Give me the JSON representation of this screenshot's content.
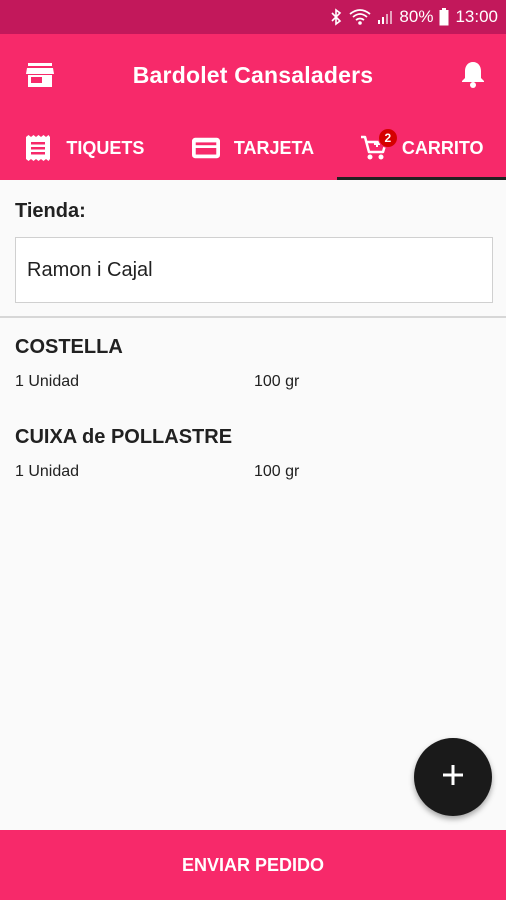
{
  "status_bar": {
    "battery": "80%",
    "time": "13:00",
    "icons": [
      "bluetooth-icon",
      "wifi-icon",
      "signal-icon",
      "battery-icon"
    ]
  },
  "app_bar": {
    "title": "Bardolet Cansaladers",
    "left_icon": "store-icon",
    "right_icon": "bell-icon"
  },
  "tabs": [
    {
      "label": "TIQUETS",
      "icon": "receipt-icon"
    },
    {
      "label": "TARJETA",
      "icon": "credit-card-icon"
    },
    {
      "label": "CARRITO",
      "icon": "cart-icon",
      "badge": "2",
      "active": true
    }
  ],
  "store": {
    "label": "Tienda:",
    "value": "Ramon i Cajal"
  },
  "items": [
    {
      "name": "COSTELLA",
      "quantity": "1 Unidad",
      "weight": "100 gr"
    },
    {
      "name": "CUIXA de POLLASTRE",
      "quantity": "1 Unidad",
      "weight": "100 gr"
    }
  ],
  "fab": {
    "icon": "plus-icon"
  },
  "bottom": {
    "label": "ENVIAR PEDIDO"
  },
  "colors": {
    "primary": "#f7296a",
    "status_bar": "#c2185b",
    "badge": "#d50000",
    "fab": "#1a1a1a"
  }
}
